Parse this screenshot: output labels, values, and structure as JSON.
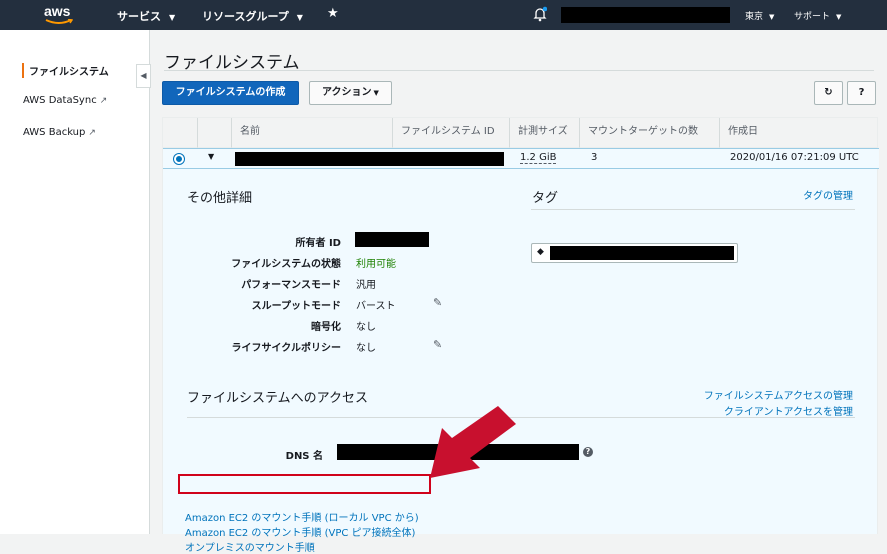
{
  "topbar": {
    "logo": "aws",
    "services": "サービス",
    "resource_groups": "リソースグループ",
    "region": "東京",
    "support": "サポート"
  },
  "sidebar": {
    "items": [
      {
        "label": "ファイルシステム",
        "active": true
      },
      {
        "label": "AWS DataSync",
        "external": true
      },
      {
        "label": "AWS Backup",
        "external": true
      }
    ]
  },
  "main": {
    "title": "ファイルシステム",
    "create_button": "ファイルシステムの作成",
    "actions_button": "アクション",
    "table": {
      "headers": [
        "名前",
        "ファイルシステム ID",
        "計測サイズ",
        "マウントターゲットの数",
        "作成日"
      ],
      "row": {
        "size": "1.2 GiB",
        "mount_targets": "3",
        "created": "2020/01/16 07:21:09 UTC"
      }
    },
    "details": {
      "section_title": "その他詳細",
      "fields": [
        {
          "label": "所有者 ID",
          "value": ""
        },
        {
          "label": "ファイルシステムの状態",
          "value": "利用可能"
        },
        {
          "label": "パフォーマンスモード",
          "value": "汎用"
        },
        {
          "label": "スループットモード",
          "value": "バースト"
        },
        {
          "label": "暗号化",
          "value": "なし"
        },
        {
          "label": "ライフサイクルポリシー",
          "value": "なし"
        }
      ]
    },
    "tags": {
      "title": "タグ",
      "manage_link": "タグの管理"
    },
    "access": {
      "title": "ファイルシステムへのアクセス",
      "manage_fs_access": "ファイルシステムアクセスの管理",
      "manage_client_access": "クライアントアクセスを管理",
      "dns_label": "DNS 名",
      "links": [
        "Amazon EC2 のマウント手順 (ローカル VPC から)",
        "Amazon EC2 のマウント手順 (VPC ピア接続全体)",
        "オンプレミスのマウント手順"
      ]
    }
  },
  "colors": {
    "primary": "#1166bb",
    "link": "#0073bb",
    "available": "#1d8102",
    "highlight": "#d0021b",
    "topbar": "#232f3e"
  }
}
